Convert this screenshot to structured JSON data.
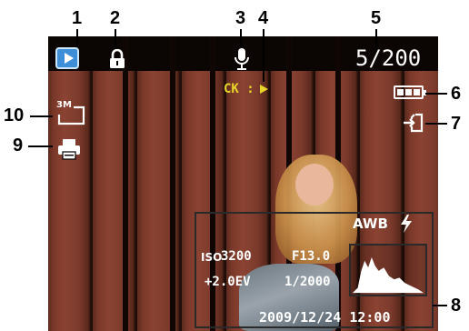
{
  "screen": {
    "frame_count": "5/200",
    "ck_label": "CK :",
    "image_size": "3M",
    "awb": "AWB",
    "iso_badge": "ISO",
    "iso_value": "3200",
    "aperture": "F13.0",
    "exposure_comp": "+2.0EV",
    "shutter_speed": "1/2000",
    "datetime": "2009/12/24  12:00"
  },
  "callouts": [
    "1",
    "2",
    "3",
    "4",
    "5",
    "6",
    "7",
    "8",
    "9",
    "10"
  ],
  "colors": {
    "play_badge": "#3f8fd8",
    "ck_text": "#e6d62a",
    "callout_text": "#000000",
    "overlay_text": "#ffffff"
  },
  "icons": {
    "playback": "play-icon",
    "protect": "lock-icon",
    "voice_memo": "microphone-icon",
    "battery": "battery-icon",
    "storage": "memory-card-icon",
    "image_size": "image-size-icon",
    "dpof": "printer-icon",
    "flash": "flash-icon",
    "histogram": "histogram-icon"
  }
}
